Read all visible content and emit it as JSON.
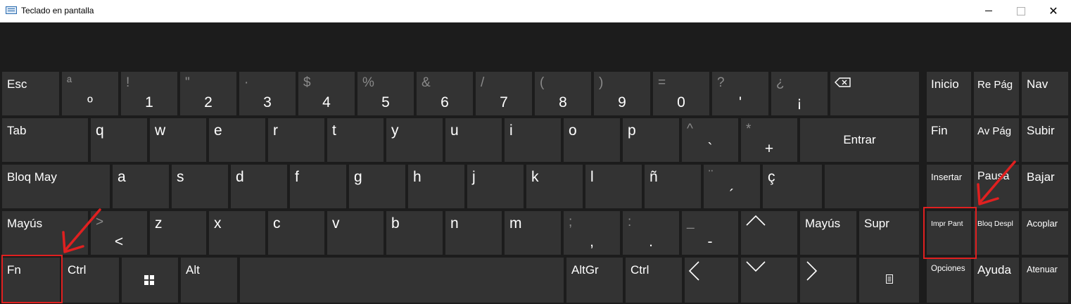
{
  "window": {
    "title": "Teclado en pantalla",
    "minimize": "",
    "maximize": "",
    "close": "✕"
  },
  "rows": {
    "r1": [
      {
        "shift": "",
        "main": "",
        "label": "Esc"
      },
      {
        "shift": "ª",
        "main": "º"
      },
      {
        "shift": "!",
        "main": "1"
      },
      {
        "shift": "\"",
        "main": "2"
      },
      {
        "shift": "·",
        "main": "3"
      },
      {
        "shift": "$",
        "main": "4"
      },
      {
        "shift": "%",
        "main": "5"
      },
      {
        "shift": "&",
        "main": "6"
      },
      {
        "shift": "/",
        "main": "7"
      },
      {
        "shift": "(",
        "main": "8"
      },
      {
        "shift": ")",
        "main": "9"
      },
      {
        "shift": "=",
        "main": "0"
      },
      {
        "shift": "?",
        "main": "'"
      },
      {
        "shift": "¿",
        "main": "¡"
      }
    ],
    "r2": [
      {
        "label": "Tab"
      },
      {
        "label": "q"
      },
      {
        "label": "w"
      },
      {
        "label": "e"
      },
      {
        "label": "r"
      },
      {
        "label": "t"
      },
      {
        "label": "y"
      },
      {
        "label": "u"
      },
      {
        "label": "i"
      },
      {
        "label": "o"
      },
      {
        "label": "p"
      },
      {
        "shift": "^",
        "main": "`"
      },
      {
        "shift": "*",
        "main": "+"
      },
      {
        "label": "Entrar"
      }
    ],
    "r3": [
      {
        "label": "Bloq May"
      },
      {
        "label": "a"
      },
      {
        "label": "s"
      },
      {
        "label": "d"
      },
      {
        "label": "f"
      },
      {
        "label": "g"
      },
      {
        "label": "h"
      },
      {
        "label": "j"
      },
      {
        "label": "k"
      },
      {
        "label": "l"
      },
      {
        "label": "ñ"
      },
      {
        "shift": "¨",
        "main": "´"
      },
      {
        "label": "ç"
      }
    ],
    "r4": [
      {
        "label": "Mayús"
      },
      {
        "shift": ">",
        "main": "<"
      },
      {
        "label": "z"
      },
      {
        "label": "x"
      },
      {
        "label": "c"
      },
      {
        "label": "v"
      },
      {
        "label": "b"
      },
      {
        "label": "n"
      },
      {
        "label": "m"
      },
      {
        "shift": ";",
        "main": ","
      },
      {
        "shift": ":",
        "main": "."
      },
      {
        "shift": "_",
        "main": "-"
      },
      {
        "label": "Mayús"
      },
      {
        "label": "Supr"
      }
    ],
    "r5": [
      {
        "label": "Fn"
      },
      {
        "label": "Ctrl"
      },
      {
        "label": "Alt"
      },
      {
        "label": "AltGr"
      },
      {
        "label": "Ctrl"
      }
    ]
  },
  "nav": {
    "inicio": "Inicio",
    "re_pag": "Re Pág",
    "nav": "Nav",
    "fin": "Fin",
    "av_pag": "Av Pág",
    "subir": "Subir",
    "insertar": "Insertar",
    "pausa": "Pausa",
    "bajar": "Bajar",
    "impr_pant": "Impr Pant",
    "bloq_despl": "Bloq Despl",
    "acoplar": "Acoplar",
    "opciones": "Opciones",
    "ayuda": "Ayuda",
    "atenuar": "Atenuar"
  },
  "colors": {
    "key": "#333333",
    "background": "#1c1c1c",
    "highlight": "#e02020"
  },
  "icons": [
    "backspace-icon",
    "windows-icon",
    "up-arrow-icon",
    "down-arrow-icon",
    "left-arrow-icon",
    "right-arrow-icon",
    "context-menu-icon",
    "keyboard-icon"
  ]
}
